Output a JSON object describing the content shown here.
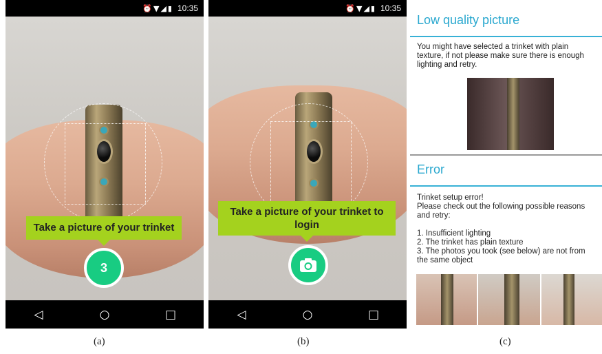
{
  "status_bar": {
    "time": "10:35",
    "icons": "⏰▼◢▮"
  },
  "nav": {
    "back_icon": "◁",
    "home_icon": "○",
    "recent_icon": "□"
  },
  "phone_a": {
    "prompt": "Take a picture of your trinket",
    "countdown": "3"
  },
  "phone_b": {
    "prompt": "Take a picture of your trinket to login",
    "camera_icon": "camera-icon"
  },
  "panel_c": {
    "low_quality": {
      "title": "Low quality picture",
      "message": "You might have selected a trinket with plain texture, if not please make sure there is enough  lighting and retry."
    },
    "error": {
      "title": "Error",
      "line1": "Trinket setup error!",
      "line2": "Please check out the following possible reasons and retry:",
      "reason1": "1. Insufficient lighting",
      "reason2": "2. The trinket has plain texture",
      "reason3": "3. The photos you took (see below) are not from the same object"
    }
  },
  "captions": {
    "a": "(a)",
    "b": "(b)",
    "c": "(c)"
  },
  "colors": {
    "prompt_green": "#a4d21e",
    "button_green": "#18cc82",
    "dialog_blue": "#2aa8cf"
  }
}
